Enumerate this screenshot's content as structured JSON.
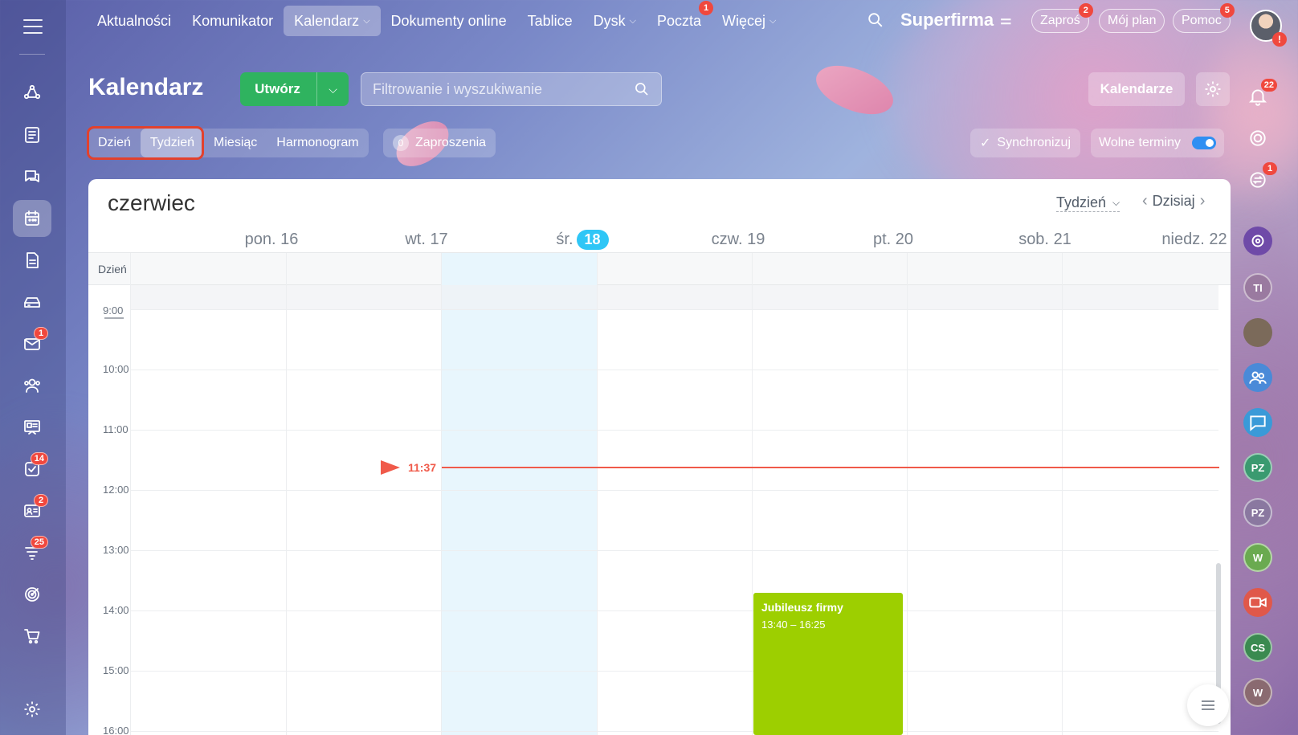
{
  "top_nav": {
    "items": [
      {
        "label": "Aktualności",
        "active": false
      },
      {
        "label": "Komunikator",
        "active": false
      },
      {
        "label": "Kalendarz",
        "active": true,
        "has_dropdown": true
      },
      {
        "label": "Dokumenty online",
        "active": false
      },
      {
        "label": "Tablice",
        "active": false
      },
      {
        "label": "Dysk",
        "active": false,
        "has_dropdown": true
      },
      {
        "label": "Poczta",
        "active": false,
        "badge": "1"
      },
      {
        "label": "Więcej",
        "active": false,
        "has_dropdown": true
      }
    ],
    "company": "Superfirma",
    "invite_label": "Zaproś",
    "invite_badge": "2",
    "plan_label": "Mój plan",
    "help_label": "Pomoc",
    "help_badge": "5",
    "avatar_alert": "!"
  },
  "left_sidebar": {
    "icons": [
      {
        "name": "activity-stream-icon",
        "active": false
      },
      {
        "name": "tasks-list-icon",
        "active": false
      },
      {
        "name": "chat-icon",
        "active": false
      },
      {
        "name": "calendar-icon",
        "active": true
      },
      {
        "name": "document-icon",
        "active": false
      },
      {
        "name": "drive-icon",
        "active": false
      },
      {
        "name": "mail-icon",
        "active": false,
        "badge": "1"
      },
      {
        "name": "employees-icon",
        "active": false
      },
      {
        "name": "presentation-icon",
        "active": false
      },
      {
        "name": "checklist-icon",
        "active": false,
        "badge": "14"
      },
      {
        "name": "crm-card-icon",
        "active": false,
        "badge": "2"
      },
      {
        "name": "funnel-icon",
        "active": false,
        "badge": "25"
      },
      {
        "name": "target-icon",
        "active": false
      },
      {
        "name": "shop-cart-icon",
        "active": false
      }
    ]
  },
  "page": {
    "title": "Kalendarz",
    "create_label": "Utwórz",
    "search_placeholder": "Filtrowanie i wyszukiwanie",
    "calendars_label": "Kalendarze"
  },
  "views": {
    "items": [
      {
        "label": "Dzień",
        "active": false
      },
      {
        "label": "Tydzień",
        "active": true
      },
      {
        "label": "Miesiąc",
        "active": false
      },
      {
        "label": "Harmonogram",
        "active": false
      }
    ],
    "invites_count": "0",
    "invites_label": "Zaproszenia",
    "sync_label": "Synchronizuj",
    "free_slots_label": "Wolne terminy",
    "free_slots_enabled": true
  },
  "right_sidebar": {
    "notifications_badge": "22",
    "chat_badge": "1",
    "avatars": [
      "TI",
      "PZ",
      "PZ",
      "W",
      "CS",
      "W"
    ]
  },
  "calendar": {
    "month": "czerwiec",
    "period": "Tydzień",
    "today_label": "Dzisiaj",
    "allday_label": "Dzień",
    "days": [
      {
        "name": "pon.",
        "num": "16",
        "today": false
      },
      {
        "name": "wt.",
        "num": "17",
        "today": false
      },
      {
        "name": "śr.",
        "num": "18",
        "today": true
      },
      {
        "name": "czw.",
        "num": "19",
        "today": false
      },
      {
        "name": "pt.",
        "num": "20",
        "today": false
      },
      {
        "name": "sob.",
        "num": "21",
        "today": false
      },
      {
        "name": "niedz.",
        "num": "22",
        "today": false
      }
    ],
    "hours": [
      "9:00",
      "10:00",
      "11:00",
      "12:00",
      "13:00",
      "14:00",
      "15:00",
      "16:00"
    ],
    "now_time": "11:37",
    "events": [
      {
        "title": "Jubileusz firmy",
        "time": "13:40 – 16:25",
        "day": "pt.",
        "color": "#9dcf00"
      }
    ]
  },
  "colors": {
    "accent_green": "#2fb35f",
    "today_blue": "#2fc6f6",
    "now_red": "#f05a4a",
    "highlight_red": "#e2412d",
    "badge_red": "#f0483e"
  }
}
